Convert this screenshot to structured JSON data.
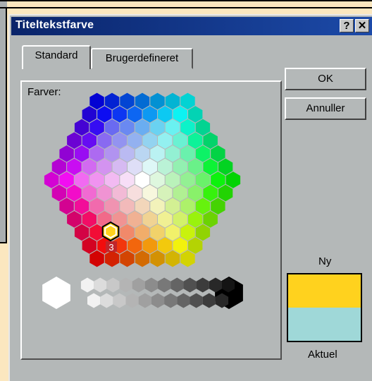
{
  "dialog": {
    "title": "Titeltekstfarve",
    "help_button": "?",
    "close_button": "✕"
  },
  "tabs": [
    {
      "label": "Standard",
      "active": true
    },
    {
      "label": "Brugerdefineret",
      "active": false
    }
  ],
  "panel": {
    "colors_label": "Farver:",
    "selected_badge": "3"
  },
  "buttons": {
    "ok": "OK",
    "cancel": "Annuller"
  },
  "preview": {
    "new_label": "Ny",
    "current_label": "Aktuel",
    "new_color": "#ffd21e",
    "current_color": "#9fd8d8"
  },
  "grayscale": [
    "#ffffff",
    "#f2f2f2",
    "#dcdcdc",
    "#c8c8c8",
    "#b4b4b4",
    "#a0a0a0",
    "#8c8c8c",
    "#787878",
    "#646464",
    "#505050",
    "#3c3c3c",
    "#282828",
    "#141414",
    "#000000"
  ]
}
